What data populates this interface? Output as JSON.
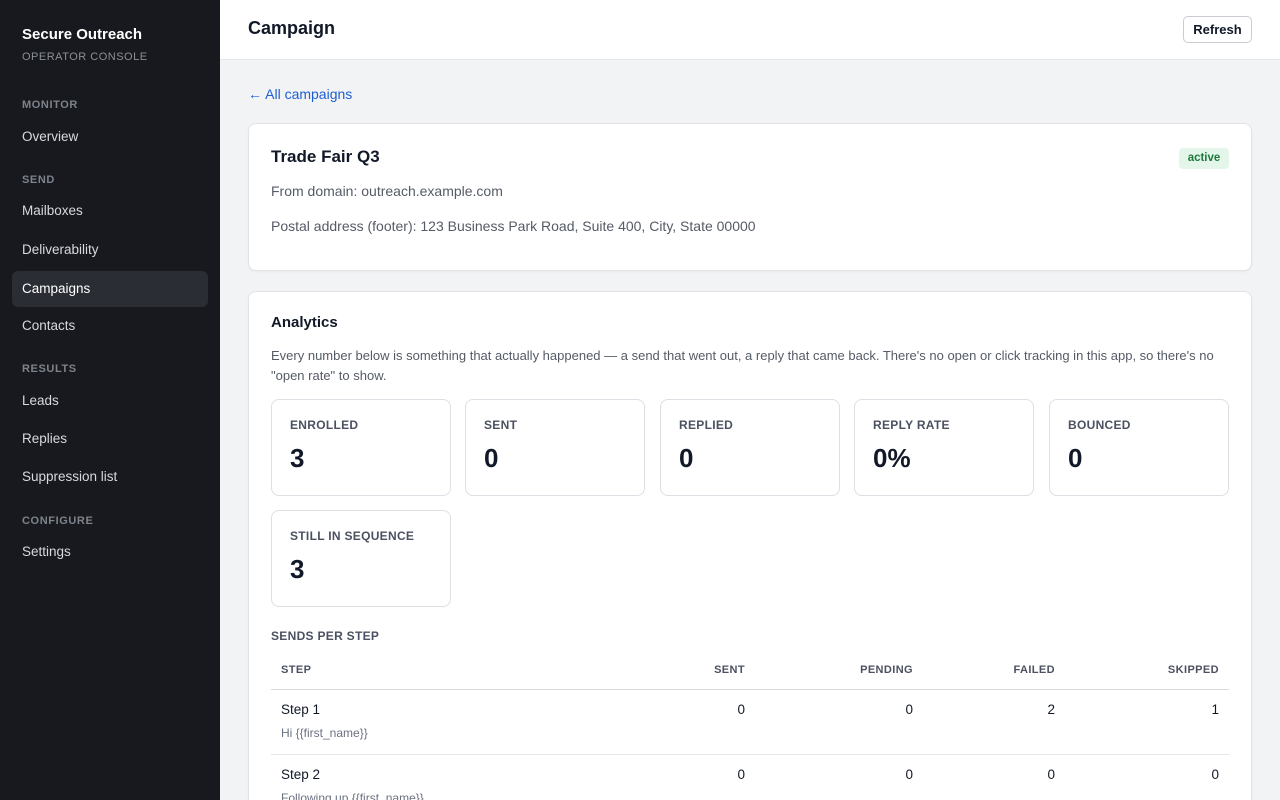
{
  "sidebar": {
    "brand": "Secure Outreach",
    "brand_sub": "OPERATOR CONSOLE",
    "sections": {
      "monitor": "MONITOR",
      "send": "SEND",
      "results": "RESULTS",
      "configure": "CONFIGURE"
    },
    "items": {
      "overview": "Overview",
      "mailboxes": "Mailboxes",
      "deliverability": "Deliverability",
      "campaigns": "Campaigns",
      "contacts": "Contacts",
      "leads": "Leads",
      "replies": "Replies",
      "suppression": "Suppression list",
      "settings": "Settings"
    },
    "active_item": "Campaigns"
  },
  "header": {
    "title": "Campaign",
    "refresh_label": "Refresh"
  },
  "back_link": "← All campaigns",
  "campaign": {
    "name": "Trade Fair Q3",
    "status": "active",
    "from_domain": "From domain: outreach.example.com",
    "postal_address": "Postal address (footer): 123 Business Park Road, Suite 400, City, State 00000"
  },
  "analytics": {
    "title": "Analytics",
    "description": "Every number below is something that actually happened — a send that went out, a reply that came back. There's no open or click tracking in this app, so there's no \"open rate\" to show.",
    "stats": [
      {
        "label": "ENROLLED",
        "value": "3"
      },
      {
        "label": "SENT",
        "value": "0"
      },
      {
        "label": "REPLIED",
        "value": "0"
      },
      {
        "label": "REPLY RATE",
        "value": "0%"
      },
      {
        "label": "BOUNCED",
        "value": "0"
      },
      {
        "label": "STILL IN SEQUENCE",
        "value": "3"
      }
    ],
    "sends_per_step": {
      "title": "SENDS PER STEP",
      "headers": {
        "step": "STEP",
        "sent": "SENT",
        "pending": "PENDING",
        "failed": "FAILED",
        "skipped": "SKIPPED"
      },
      "rows": [
        {
          "step": "Step 1",
          "subject": "Hi {{first_name}}",
          "sent": "0",
          "pending": "0",
          "failed": "2",
          "skipped": "1"
        },
        {
          "step": "Step 2",
          "subject": "Following up {{first_name}}",
          "sent": "0",
          "pending": "0",
          "failed": "0",
          "skipped": "0"
        }
      ]
    }
  },
  "colors": {
    "sidebar_bg": "#17191e",
    "link": "#1d5fd0",
    "badge_bg": "#e4f5ea",
    "badge_text": "#1d7a3d"
  }
}
